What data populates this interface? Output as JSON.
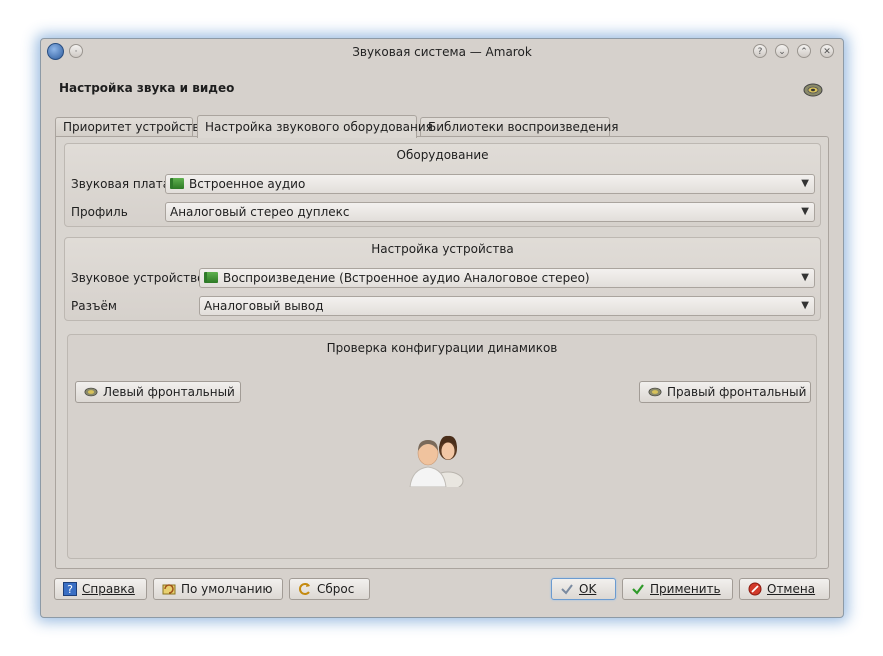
{
  "window": {
    "title": "Звуковая система — Amarok"
  },
  "page": {
    "title": "Настройка звука и видео"
  },
  "tabs": [
    {
      "label": "Приоритет устройств"
    },
    {
      "label": "Настройка звукового оборудования"
    },
    {
      "label": "Библиотеки воспроизведения"
    }
  ],
  "hardware": {
    "title": "Оборудование",
    "sound_card_label": "Звуковая плата",
    "sound_card_value": "Встроенное аудио",
    "profile_label": "Профиль",
    "profile_value": "Аналоговый стерео дуплекс"
  },
  "device": {
    "title": "Настройка устройства",
    "device_label": "Звуковое устройство",
    "device_value": "Воспроизведение (Встроенное аудио Аналоговое стерео)",
    "connector_label": "Разъём",
    "connector_value": "Аналоговый вывод"
  },
  "speaker_test": {
    "title": "Проверка конфигурации динамиков",
    "left_front": "Левый фронтальный",
    "right_front": "Правый фронтальный"
  },
  "footer": {
    "help": "Справка",
    "defaults": "По умолчанию",
    "reset": "Сброс",
    "ok": "OK",
    "apply": "Применить",
    "cancel": "Отмена"
  },
  "colors": {
    "accent_glow": "#2d7cd1",
    "window_bg": "#d6d1cc"
  }
}
